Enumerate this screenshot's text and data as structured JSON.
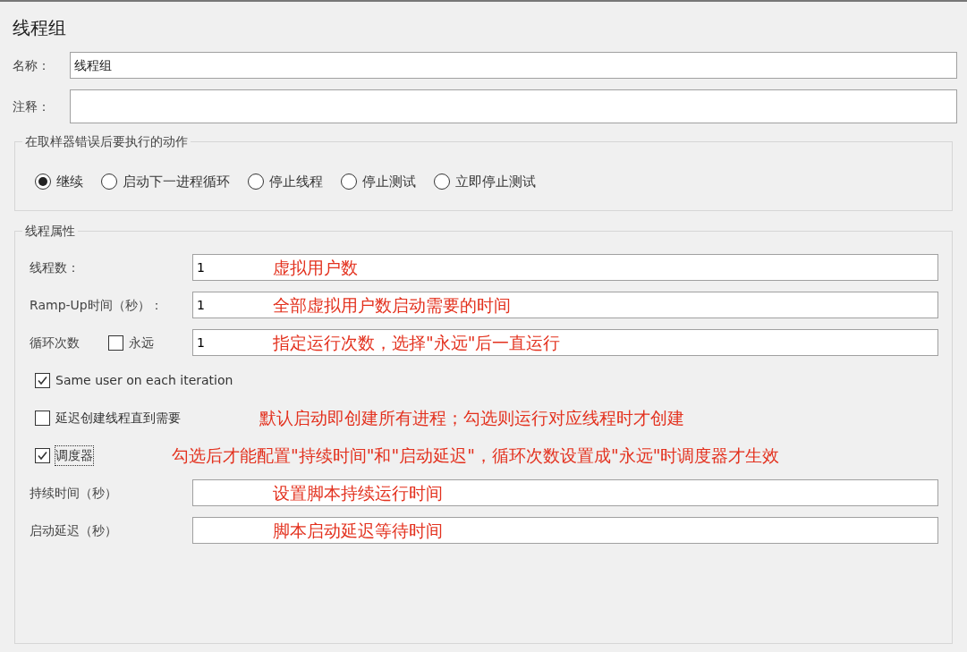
{
  "title": "线程组",
  "name_field": {
    "label": "名称：",
    "value": "线程组"
  },
  "comment_field": {
    "label": "注释："
  },
  "error_action": {
    "legend": "在取样器错误后要执行的动作",
    "options": [
      {
        "label": "继续",
        "selected": true
      },
      {
        "label": "启动下一进程循环",
        "selected": false
      },
      {
        "label": "停止线程",
        "selected": false
      },
      {
        "label": "停止测试",
        "selected": false
      },
      {
        "label": "立即停止测试",
        "selected": false
      }
    ]
  },
  "thread_properties": {
    "legend": "线程属性",
    "rows": [
      {
        "kind": "field",
        "label": "线程数：",
        "value": "1",
        "annotation": "虚拟用户数"
      },
      {
        "kind": "field",
        "label": "Ramp-Up时间（秒）：",
        "value": "1",
        "annotation": "全部虚拟用户数启动需要的时间"
      },
      {
        "kind": "loop",
        "label": "循环次数",
        "checkbox": {
          "label": "永远",
          "checked": false
        },
        "value": "1",
        "annotation": "指定运行次数，选择\"永远\"后一直运行"
      },
      {
        "kind": "checkbox",
        "label": "Same user on each iteration",
        "checked": true,
        "focused": false
      },
      {
        "kind": "checkbox",
        "label": "延迟创建线程直到需要",
        "checked": false,
        "focused": false,
        "annotation": "默认启动即创建所有进程；勾选则运行对应线程时才创建"
      },
      {
        "kind": "checkbox",
        "label": "调度器",
        "checked": true,
        "focused": true,
        "annotation": "勾选后才能配置\"持续时间\"和\"启动延迟\"，循环次数设置成\"永远\"时调度器才生效"
      },
      {
        "kind": "field",
        "label": "持续时间（秒）",
        "annotation": "设置脚本持续运行时间"
      },
      {
        "kind": "field",
        "label": "启动延迟（秒）",
        "annotation": "脚本启动延迟等待时间"
      }
    ]
  }
}
